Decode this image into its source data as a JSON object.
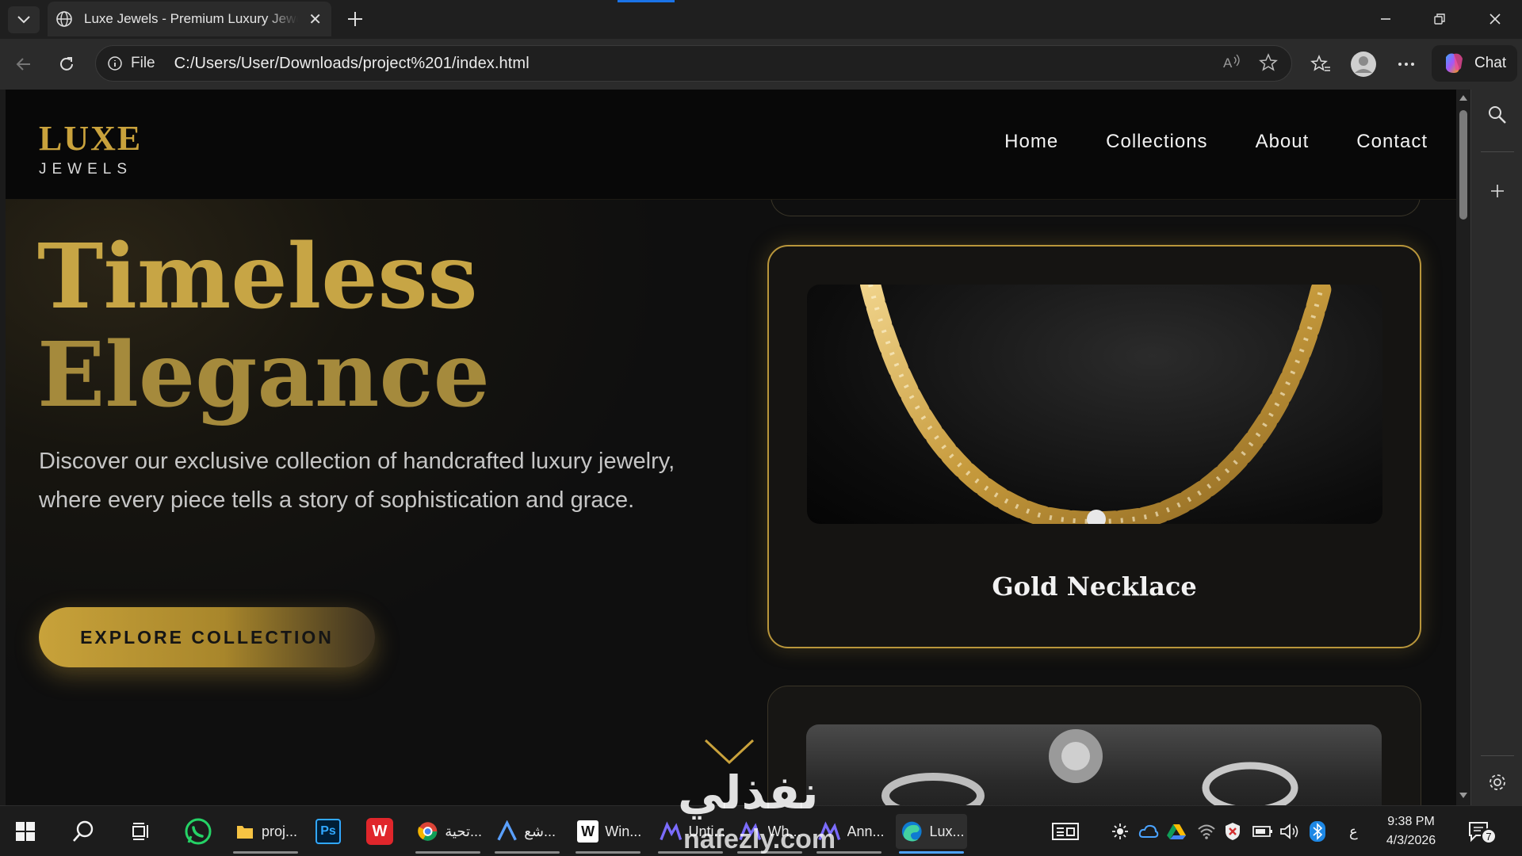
{
  "browser": {
    "tab_title": "Luxe Jewels - Premium Luxury Jewelry",
    "address_prefix": "File",
    "url": "C:/Users/User/Downloads/project%201/index.html",
    "chat_label": "Chat"
  },
  "site": {
    "logo_main": "LUXE",
    "logo_sub": "JEWELS",
    "nav": [
      "Home",
      "Collections",
      "About",
      "Contact"
    ],
    "hero_title_line1": "Timeless",
    "hero_title_line2": "Elegance",
    "hero_description": "Discover our exclusive collection of handcrafted luxury jewelry, where every piece tells a story of sophistication and grace.",
    "cta_label": "EXPLORE COLLECTION",
    "featured_card_title": "Gold Necklace",
    "colors": {
      "gold": "#c9a23c",
      "background": "#0d0d0d"
    }
  },
  "taskbar": {
    "apps": [
      {
        "label": "proj...",
        "icon": "folder-icon"
      },
      {
        "label": "Ps",
        "icon": "photoshop-icon"
      },
      {
        "label": "W",
        "icon": "wps-icon"
      },
      {
        "label": "تحية...",
        "icon": "chrome-icon"
      },
      {
        "label": "شع...",
        "icon": "app-icon"
      },
      {
        "label": "Win...",
        "icon": "app-icon"
      },
      {
        "label": "Unti...",
        "icon": "app-icon"
      },
      {
        "label": "Wh...",
        "icon": "app-icon"
      },
      {
        "label": "Ann...",
        "icon": "app-icon"
      },
      {
        "label": "Lux...",
        "icon": "edge-icon"
      }
    ],
    "time": "9:38 PM",
    "date": "4/3/2026",
    "lang": "ع",
    "notification_count": "7"
  },
  "watermark": {
    "arabic": "نفذلي",
    "latin": "nafezly.com"
  }
}
